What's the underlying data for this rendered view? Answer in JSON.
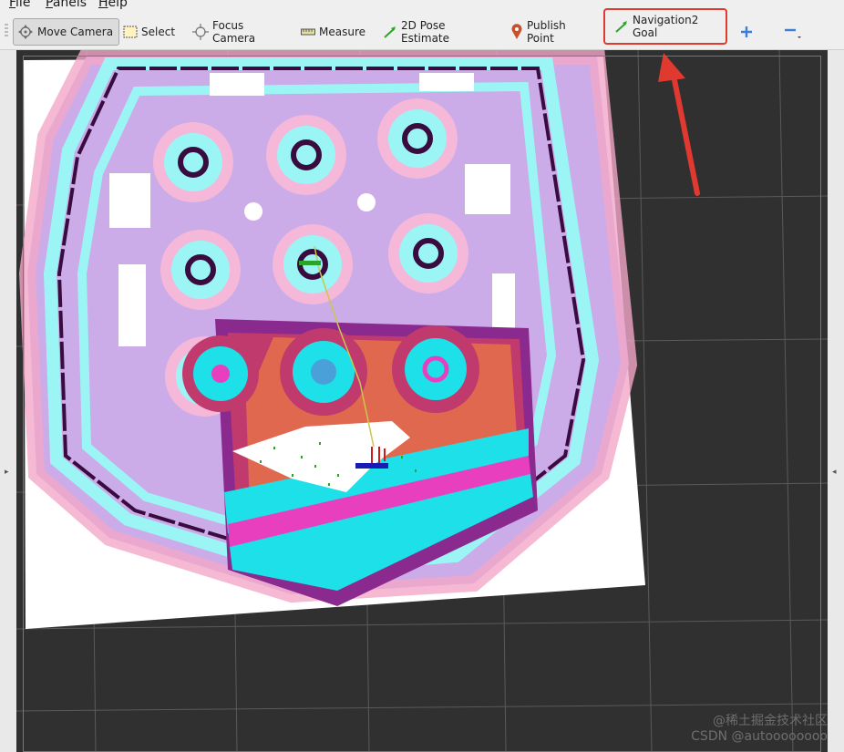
{
  "menu": {
    "file": {
      "first": "F",
      "rest": "ile"
    },
    "panels": {
      "first": "P",
      "rest": "anels"
    },
    "help": {
      "first": "H",
      "rest": "elp"
    }
  },
  "toolbar": {
    "move_camera": "Move Camera",
    "select": "Select",
    "focus_camera": "Focus Camera",
    "measure": "Measure",
    "pose_estimate": "2D Pose Estimate",
    "publish_point": "Publish Point",
    "nav2_goal": "Navigation2 Goal",
    "add_icon": "plus-icon",
    "remove_icon": "minus-icon"
  },
  "colors": {
    "grid_background": "#303030",
    "free_space": "#ffffff",
    "cost_inflation": "#c9a6e8",
    "cost_inscribed": "#9cf5f5",
    "obstacle": "#3a0b3e",
    "local_cost_high": "#8a2a8e",
    "local_cost_cyan": "#1ee0e8",
    "highlight_box": "#e0392f",
    "annotation_arrow": "#e0392f"
  },
  "watermark": {
    "line1": "@稀土掘金技术社区",
    "line2": "CSDN @autoooooooo"
  }
}
